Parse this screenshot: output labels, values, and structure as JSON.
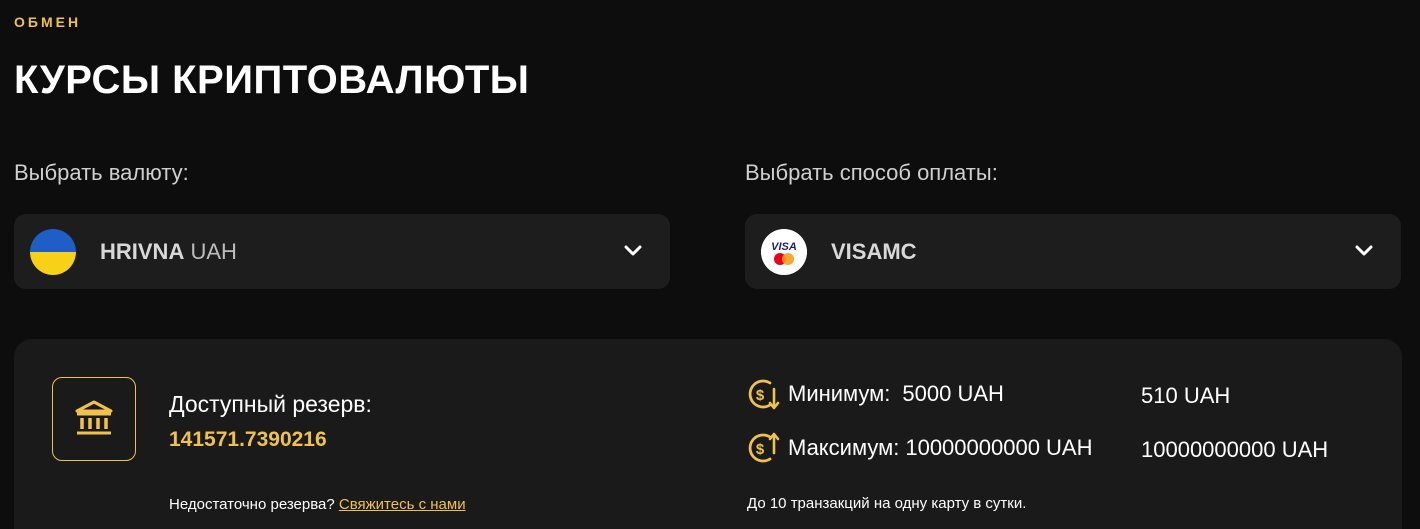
{
  "header": {
    "eyebrow": "ОБМЕН",
    "title": "КУРСЫ КРИПТОВАЛЮТЫ"
  },
  "currency": {
    "label": "Выбрать валюту:",
    "name": "HRIVNA",
    "code": "UAH",
    "flag_colors": [
      "#1f5ec7",
      "#f7d117"
    ]
  },
  "payment": {
    "label": "Выбрать способ оплаты:",
    "name": "VISAMC",
    "logo_text": "VISA"
  },
  "reserve": {
    "label": "Доступный резерв:",
    "value": "141571.7390216",
    "note_prefix": "Недостаточно резерва?",
    "contact_link": "Свяжитесь с нами"
  },
  "limits": {
    "min_label": "Минимум:",
    "min_value": "5000 UAH",
    "min_alt": "510 UAH",
    "max_label": "Максимум:",
    "max_value": "10000000000 UAH",
    "max_alt": "10000000000 UAH",
    "tx_note": "До 10 транзакций на одну карту в сутки."
  },
  "colors": {
    "accent": "#f0c24b",
    "background": "#0d0d0d",
    "card": "#1d1d1d",
    "panel": "#1a1a1a"
  }
}
